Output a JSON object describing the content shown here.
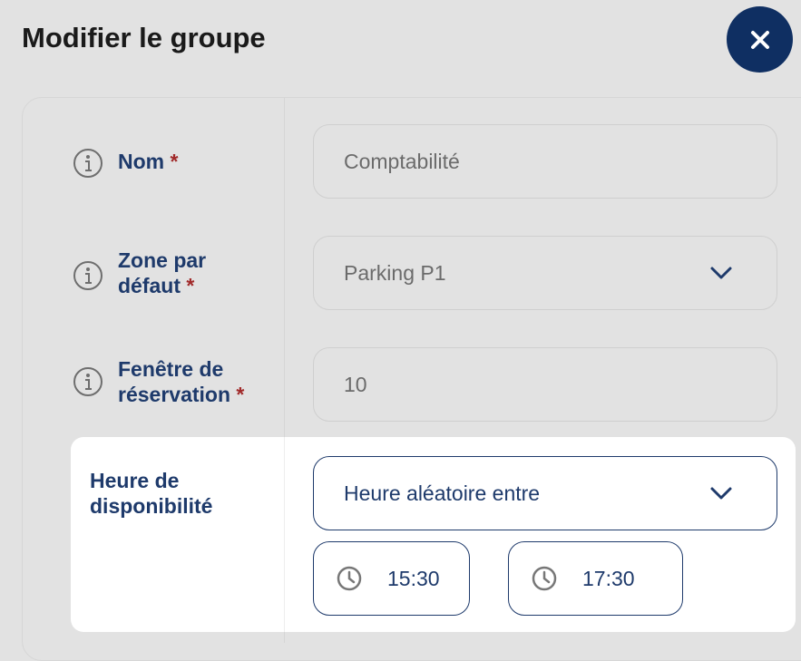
{
  "dialog": {
    "title": "Modifier le groupe",
    "close_icon": "close-icon"
  },
  "fields": {
    "nom": {
      "label": "Nom",
      "required": "*",
      "value": "Comptabilité"
    },
    "zone": {
      "label_line1": "Zone par",
      "label_line2": "défaut",
      "required": "*",
      "value": "Parking P1"
    },
    "fenetre": {
      "label_line1": "Fenêtre de",
      "label_line2": "réservation",
      "required": "*",
      "value": "10"
    },
    "heure": {
      "label_line1": "Heure de",
      "label_line2": "disponibilité",
      "mode": "Heure aléatoire entre",
      "start": "15:30",
      "end": "17:30"
    }
  },
  "colors": {
    "accent": "#1e3a6b",
    "close_button": "#0f2f62",
    "required": "#a12a2a",
    "overlay": "#e2e2e2"
  }
}
